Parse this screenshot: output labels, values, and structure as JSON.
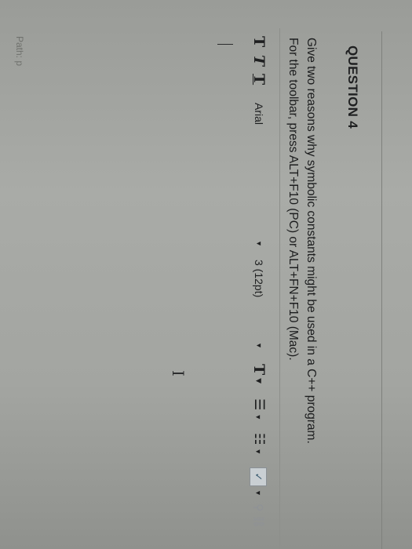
{
  "question": {
    "title": "QUESTION 4",
    "line1": "Give two reasons why symbolic constants might be used in a C++ program.",
    "line2": "For the toolbar, press ALT+F10 (PC) or ALT+FN+F10 (Mac)."
  },
  "toolbar": {
    "bold": "T",
    "italic": "T",
    "underline": "T",
    "font_family": "Arial",
    "font_size": "3 (12pt)",
    "text_color": "T",
    "bullet_list": "☰",
    "numbered_list": "☷",
    "spellcheck": "✓",
    "dropdown_arrow": "▼",
    "link": "⚲ ⛓"
  },
  "ibeam": "I",
  "status": {
    "path": "Path: p"
  }
}
